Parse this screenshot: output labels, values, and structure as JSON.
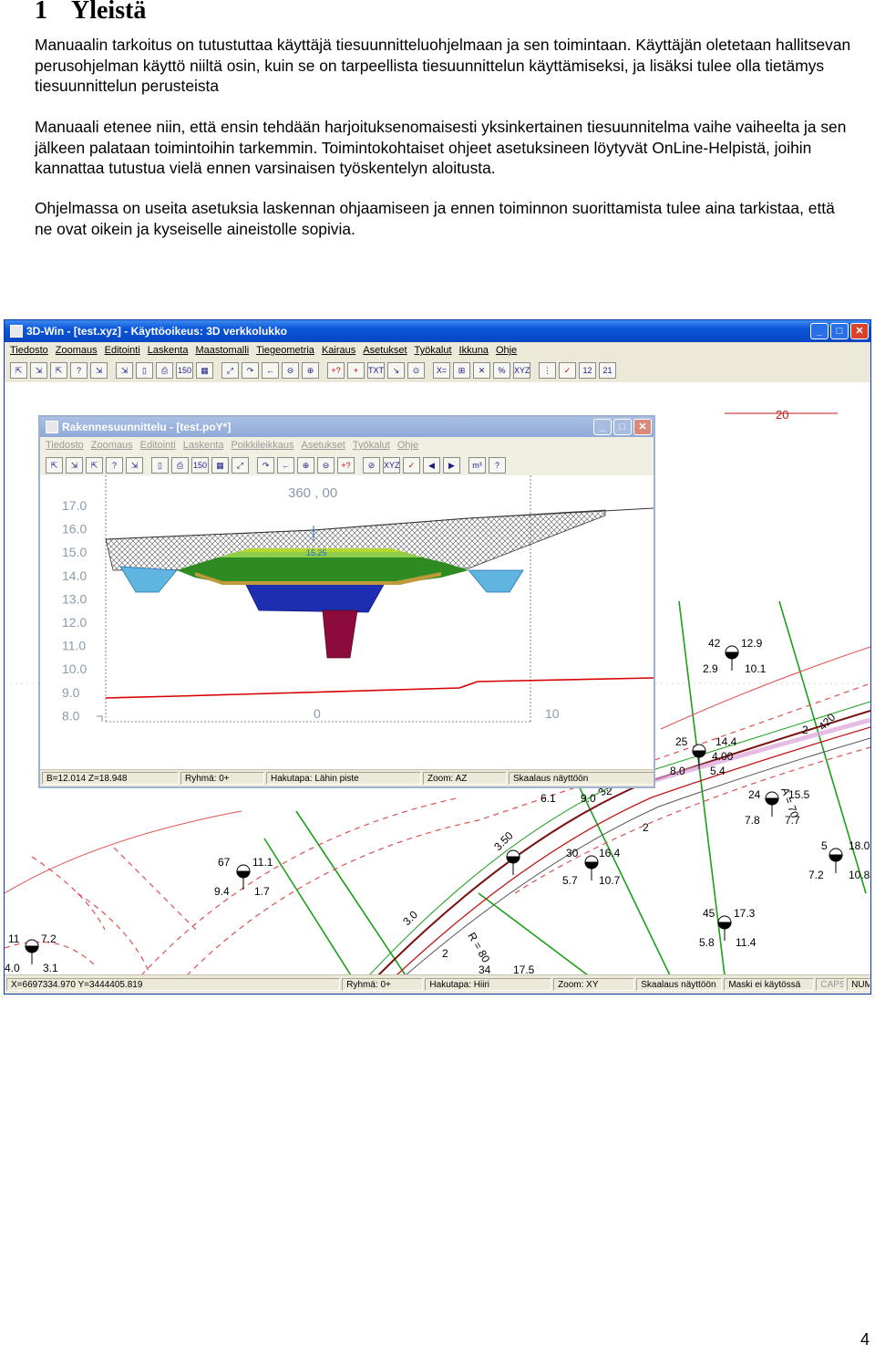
{
  "heading": {
    "number": "1",
    "title": "Yleistä"
  },
  "paragraphs": [
    "Manuaalin tarkoitus on tutustuttaa käyttäjä tiesuunnitteluohjelmaan ja sen toimintaan. Käyttäjän oletetaan hallitsevan perusohjelman käyttö niiltä osin, kuin se on tarpeellista tiesuunnittelun käyttämiseksi, ja lisäksi tulee olla tietämys tiesuunnittelun perusteista",
    "Manuaali etenee niin, että ensin tehdään harjoituksenomaisesti yksinkertainen tiesuunnitelma vaihe vaiheelta ja sen jälkeen palataan toimintoihin tarkemmin. Toimintokohtaiset ohjeet asetuksineen löytyvät OnLine-Helpistä, joihin kannattaa tutustua vielä ennen varsinaisen työskentelyn aloitusta.",
    "Ohjelmassa on useita asetuksia laskennan ohjaamiseen ja ennen toiminnon suorittamista tulee aina tarkistaa, että ne ovat oikein ja kyseiselle aineistolle sopivia."
  ],
  "main_window": {
    "title": "3D-Win - [test.xyz] - Käyttöoikeus: 3D verkkolukko",
    "menu": [
      "Tiedosto",
      "Zoomaus",
      "Editointi",
      "Laskenta",
      "Maastomalli",
      "Tiegeometria",
      "Kairaus",
      "Asetukset",
      "Työkalut",
      "Ikkuna",
      "Ohje"
    ],
    "toolbar": [
      "⇱",
      "⇲",
      "⇱",
      "?",
      "⇲",
      "⇲",
      "▯",
      "⎙",
      "150",
      "▦",
      "⤢",
      "↷",
      "←",
      "⊖",
      "⊕",
      "+?",
      "+",
      "TXT",
      "↘",
      "⊙",
      "X=",
      "⊞",
      "✕",
      "%",
      "XYZ",
      "⋮",
      "✓",
      "12",
      "21"
    ],
    "status": [
      "X=6697334.970  Y=3444405.819",
      "Ryhmä: 0+",
      "Hakutapa: Hiiri",
      "Zoom: XY",
      "Skaalaus näyttöön",
      "Maski ei käytössä",
      "CAPS",
      "NUM"
    ],
    "map_labels": [
      "20",
      "42",
      "12.9",
      "2.9",
      "10.1",
      "25",
      "14.4",
      "4.00",
      "8.0",
      "5.4",
      "6.1",
      "9.0",
      "3.60",
      "420",
      "24",
      "15.5",
      "7.8",
      "7.7",
      "67",
      "11.1",
      "9.4",
      "1.7",
      "3.50",
      "30",
      "16.4",
      "5.7",
      "10.7",
      "5",
      "18.0",
      "7.2",
      "10.8",
      "11",
      "7.2",
      "45",
      "17.3",
      "5.8",
      "11.4",
      "4.0",
      "3.1",
      "3.0",
      "34",
      "17.5",
      "R = 80",
      "A = 70",
      "2",
      "2",
      "2",
      "2"
    ]
  },
  "profile_window": {
    "title": "Rakennesuunnittelu - [test.poY*]",
    "menu": [
      "Tiedosto",
      "Zoomaus",
      "Editointi",
      "Laskenta",
      "Poikkileikkaus",
      "Asetukset",
      "Työkalut",
      "Ohje"
    ],
    "toolbar": [
      "⇱",
      "⇲",
      "⇱",
      "?",
      "⇲",
      "▯",
      "⎙",
      "150",
      "▦",
      "⤢",
      "↷",
      "←",
      "⊕",
      "⊖",
      "+?",
      "⊘",
      "XYZ",
      "✓",
      "◀",
      "▶",
      "m³",
      "?"
    ],
    "status": [
      "B=12.014  Z=18.948",
      "Ryhmä: 0+",
      "Hakutapa: Lähin piste",
      "Zoom: AZ",
      "Skaalaus näyttöön"
    ],
    "station": "360 , 00",
    "center_label": "15.25",
    "y_ticks": [
      "17.0",
      "16.0",
      "15.0",
      "14.0",
      "13.0",
      "12.0",
      "11.0",
      "10.0",
      "9.0",
      "8.0"
    ],
    "x_ticks": [
      "0",
      "10"
    ]
  },
  "page_number": "4",
  "colors": {
    "title_blue": "#0a55d8",
    "road_red": "#d80000",
    "line_green": "#1aa01a",
    "embank_green": "#2e8b22"
  }
}
